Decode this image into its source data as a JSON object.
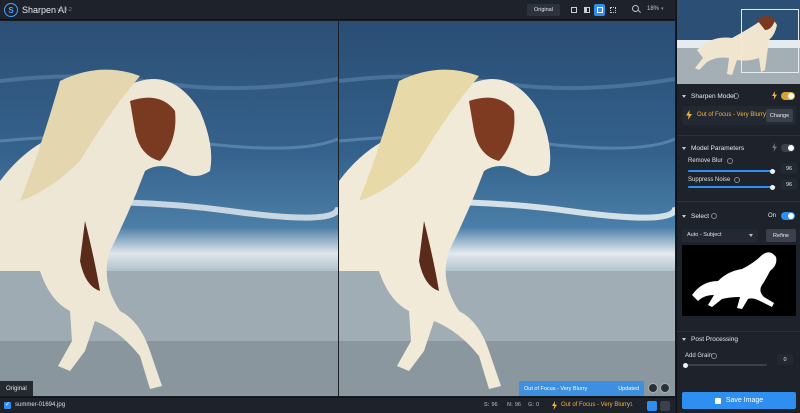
{
  "app": {
    "name": "Sharpen AI",
    "version": "v3.3.2"
  },
  "toolbar": {
    "original_label": "Original",
    "zoom": "18%"
  },
  "view_modes": [
    {
      "name": "single-view",
      "active": false
    },
    {
      "name": "split-view",
      "active": false
    },
    {
      "name": "side-by-side-view",
      "active": true
    },
    {
      "name": "grid-view",
      "active": false
    }
  ],
  "canvas": {
    "original_tag": "Original",
    "status_model": "Out of Focus - Very Blurry",
    "status_state": "Updated"
  },
  "bottom": {
    "filename": "summer-01694.jpg",
    "stats": [
      {
        "key": "S:",
        "value": "96"
      },
      {
        "key": "N:",
        "value": "96"
      },
      {
        "key": "G:",
        "value": "0"
      }
    ],
    "model": "Out of Focus - Very Blurry",
    "version": "v1"
  },
  "sidebar": {
    "sharpen_model": {
      "title": "Sharpen Model",
      "model_name": "Out of Focus - Very Blurry",
      "change_label": "Change"
    },
    "model_parameters": {
      "title": "Model Parameters",
      "remove_blur": {
        "label": "Remove Blur",
        "value": "96",
        "fraction": 0.96
      },
      "suppress_noise": {
        "label": "Suppress Noise",
        "value": "96",
        "fraction": 0.96
      }
    },
    "select": {
      "title": "Select",
      "on_label": "On",
      "mode": "Auto - Subject",
      "refine_label": "Refine"
    },
    "post_processing": {
      "title": "Post Processing",
      "add_grain": {
        "label": "Add Grain",
        "value": "0",
        "fraction": 0.0
      }
    },
    "save_label": "Save Image"
  },
  "colors": {
    "accent": "#2f8ff0",
    "model_gold": "#f2b43b",
    "panel": "#1d222b"
  }
}
